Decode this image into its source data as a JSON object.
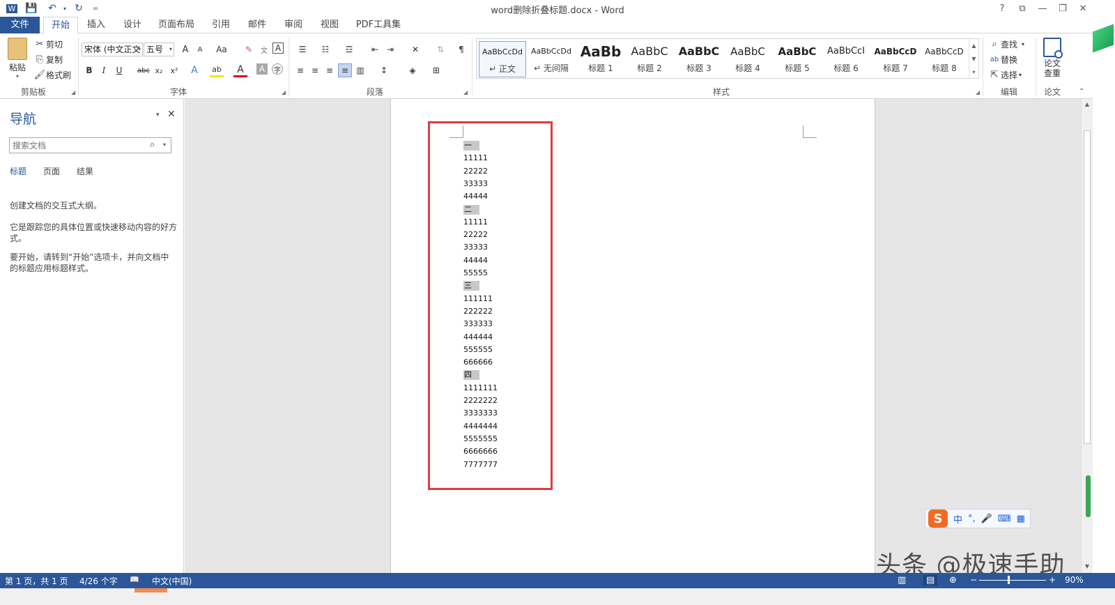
{
  "window": {
    "title": "word删除折叠标题.docx - Word",
    "controls": {
      "help": "?",
      "ribbon_options": "⧉",
      "minimize": "—",
      "restore": "❐",
      "close": "✕"
    }
  },
  "qat": {
    "word_icon": "W",
    "save": "💾",
    "undo": "↶",
    "undo_dd": "▾",
    "redo": "↻",
    "more": "="
  },
  "tabs": [
    "文件",
    "开始",
    "插入",
    "设计",
    "页面布局",
    "引用",
    "邮件",
    "审阅",
    "视图",
    "PDF工具集"
  ],
  "ribbon": {
    "clipboard": {
      "paste": "粘贴",
      "cut": "剪切",
      "copy": "复制",
      "format_painter": "格式刷",
      "label": "剪贴板"
    },
    "font": {
      "font_name": "宋体 (中文正文",
      "font_size": "五号",
      "grow": "A",
      "shrink": "A",
      "case": "Aa",
      "clear": "✎",
      "phonetic": "文",
      "border_char": "A",
      "bold": "B",
      "italic": "I",
      "underline": "U",
      "strike": "abc",
      "subscript": "x₂",
      "superscript": "x²",
      "text_effect": "A",
      "highlight": "ab",
      "font_color": "A",
      "shading": "A",
      "enclose": "字",
      "label": "字体"
    },
    "paragraph": {
      "label": "段落"
    },
    "styles": {
      "label": "样式",
      "items": [
        {
          "preview": "AaBbCcDd",
          "name": "↵ 正文"
        },
        {
          "preview": "AaBbCcDd",
          "name": "↵ 无间隔"
        },
        {
          "preview": "AaBb",
          "name": "标题 1"
        },
        {
          "preview": "AaBbC",
          "name": "标题 2"
        },
        {
          "preview": "AaBbC",
          "name": "标题 3"
        },
        {
          "preview": "AaBbC",
          "name": "标题 4"
        },
        {
          "preview": "AaBbC",
          "name": "标题 5"
        },
        {
          "preview": "AaBbCcI",
          "name": "标题 6"
        },
        {
          "preview": "AaBbCcD",
          "name": "标题 7"
        },
        {
          "preview": "AaBbCcD",
          "name": "标题 8"
        }
      ]
    },
    "editing": {
      "find": "查找",
      "replace": "替换",
      "select": "选择",
      "label": "编辑"
    },
    "paper": {
      "check": "论文查重",
      "label": "论文"
    }
  },
  "nav": {
    "title": "导航",
    "search_placeholder": "搜索文档",
    "tabs": [
      "标题",
      "页面",
      "结果"
    ],
    "text1": "创建文档的交互式大纲。",
    "text2": "它是跟踪您的具体位置或快速移动内容的好方式。",
    "text3": "要开始，请转到“开始”选项卡，并向文档中的标题应用标题样式。"
  },
  "document": {
    "lines": [
      {
        "text": "一",
        "heading": true
      },
      {
        "text": "11111",
        "heading": false
      },
      {
        "text": "22222",
        "heading": false
      },
      {
        "text": "33333",
        "heading": false
      },
      {
        "text": "44444",
        "heading": false
      },
      {
        "text": "二",
        "heading": true
      },
      {
        "text": "11111",
        "heading": false
      },
      {
        "text": "22222",
        "heading": false
      },
      {
        "text": "33333",
        "heading": false
      },
      {
        "text": "44444",
        "heading": false
      },
      {
        "text": "55555",
        "heading": false
      },
      {
        "text": "三",
        "heading": true
      },
      {
        "text": "111111",
        "heading": false
      },
      {
        "text": "222222",
        "heading": false
      },
      {
        "text": "333333",
        "heading": false
      },
      {
        "text": "444444",
        "heading": false
      },
      {
        "text": "555555",
        "heading": false
      },
      {
        "text": "666666",
        "heading": false
      },
      {
        "text": "四",
        "heading": true
      },
      {
        "text": "1111111",
        "heading": false
      },
      {
        "text": "2222222",
        "heading": false
      },
      {
        "text": "3333333",
        "heading": false
      },
      {
        "text": "4444444",
        "heading": false
      },
      {
        "text": "5555555",
        "heading": false
      },
      {
        "text": "6666666",
        "heading": false
      },
      {
        "text": "7777777",
        "heading": false
      }
    ],
    "highlight_color": "#e03c3c"
  },
  "ime": {
    "logo": "S",
    "mode": "中",
    "punct": "°,",
    "mic": "🎤",
    "keyboard": "⌨",
    "grid": "▦"
  },
  "watermark": "头条 @极速手助",
  "status": {
    "page": "第 1 页，共 1 页",
    "words": "4/26 个字",
    "proof": "📖",
    "lang": "中文(中国)",
    "zoom": "90%",
    "zoom_minus": "−",
    "zoom_plus": "+"
  },
  "colors": {
    "accent": "#2b579a",
    "status_bar": "#2b579a"
  }
}
